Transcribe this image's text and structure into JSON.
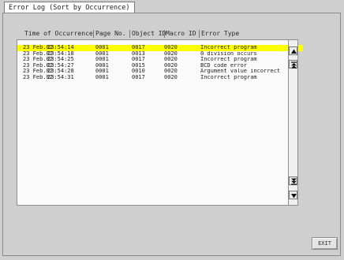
{
  "window": {
    "title": "Error Log (Sort by Occurrence)"
  },
  "columns": {
    "time": "Time of Occurrence",
    "page": "Page No.",
    "object": "Object ID",
    "macro": "Macro ID",
    "type": "Error Type"
  },
  "rows": [
    {
      "date": "23 Feb.02",
      "time": "23:54:14",
      "page": "0001",
      "object": "0017",
      "macro": "0020",
      "type": "Incorrect program"
    },
    {
      "date": "23 Feb.02",
      "time": "23:54:18",
      "page": "0001",
      "object": "0013",
      "macro": "0020",
      "type": "0 division occurs"
    },
    {
      "date": "23 Feb.02",
      "time": "23:54:25",
      "page": "0001",
      "object": "0017",
      "macro": "0020",
      "type": "Incorrect program"
    },
    {
      "date": "23 Feb.02",
      "time": "23:54:27",
      "page": "0001",
      "object": "0015",
      "macro": "0020",
      "type": "BCD code error"
    },
    {
      "date": "23 Feb.02",
      "time": "23:54:28",
      "page": "0001",
      "object": "0010",
      "macro": "0020",
      "type": "Argument value incorrect"
    },
    {
      "date": "23 Feb.02",
      "time": "23:54:31",
      "page": "0001",
      "object": "0017",
      "macro": "0020",
      "type": "Incorrect program"
    }
  ],
  "selected_row": 0,
  "colors": {
    "selected": "#ffff00",
    "background": "#cfcfcf"
  },
  "scroll_icons": [
    "arrow-up-icon",
    "page-up-icon",
    "page-down-icon",
    "arrow-down-icon"
  ],
  "buttons": {
    "exit": "EXIT"
  }
}
